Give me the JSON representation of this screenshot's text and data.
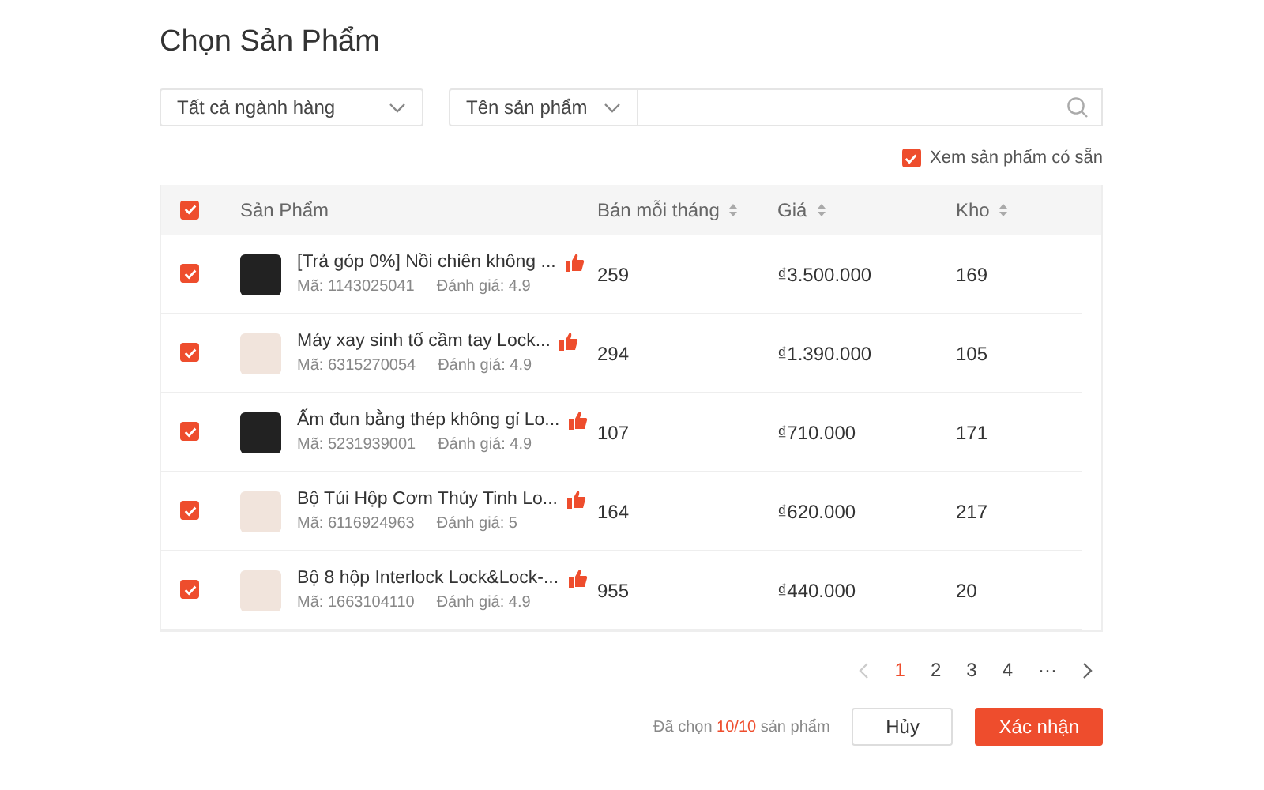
{
  "title": "Chọn Sản Phẩm",
  "category_filter": {
    "value": "Tất cả ngành hàng"
  },
  "search": {
    "field": "Tên sản phẩm"
  },
  "in_stock_filter": {
    "label": "Xem sản phẩm có sẵn",
    "checked": true
  },
  "table": {
    "select_all": {
      "checked": true
    },
    "columns": [
      {
        "label": "Sản Phẩm",
        "sortable": false
      },
      {
        "label": "Bán mỗi tháng",
        "sortable": true
      },
      {
        "label": "Giá",
        "sortable": true
      },
      {
        "label": "Kho",
        "sortable": true
      }
    ],
    "rows": [
      {
        "checked": true,
        "name": "[Trả góp 0%] Nồi chiên không ...",
        "code": "Mã: 1143025041",
        "rating": "Đánh giá: 4.9",
        "sold": "259",
        "price": "₫3.500.000",
        "stock": "169"
      },
      {
        "checked": true,
        "name": "Máy xay sinh tố cầm tay Lock...",
        "code": "Mã: 6315270054",
        "rating": "Đánh giá: 4.9",
        "sold": "294",
        "price": "₫1.390.000",
        "stock": "105"
      },
      {
        "checked": true,
        "name": "Ấm đun bằng thép không gỉ Lo...",
        "code": "Mã: 5231939001",
        "rating": "Đánh giá: 4.9",
        "sold": "107",
        "price": "₫710.000",
        "stock": "171"
      },
      {
        "checked": true,
        "name": "Bộ Túi Hộp Cơm Thủy Tinh Lo...",
        "code": "Mã: 6116924963",
        "rating": "Đánh giá: 5",
        "sold": "164",
        "price": "₫620.000",
        "stock": "217"
      },
      {
        "checked": true,
        "name": "Bộ 8 hộp Interlock Lock&Lock-...",
        "code": "Mã: 1663104110",
        "rating": "Đánh giá: 4.9",
        "sold": "955",
        "price": "₫440.000",
        "stock": "20"
      }
    ]
  },
  "pagination": {
    "pages": [
      {
        "label": "1",
        "selected": true
      },
      {
        "label": "2",
        "selected": false
      },
      {
        "label": "3",
        "selected": false
      },
      {
        "label": "4",
        "selected": false
      },
      {
        "label": "···",
        "selected": false
      }
    ]
  },
  "footer": {
    "prefix": "Đã chọn",
    "count": "10/10",
    "suffix": "sản phẩm",
    "buttons": [
      {
        "label": "Hủy",
        "kind": "secondary"
      },
      {
        "label": "Xác nhận",
        "kind": "primary"
      }
    ]
  }
}
